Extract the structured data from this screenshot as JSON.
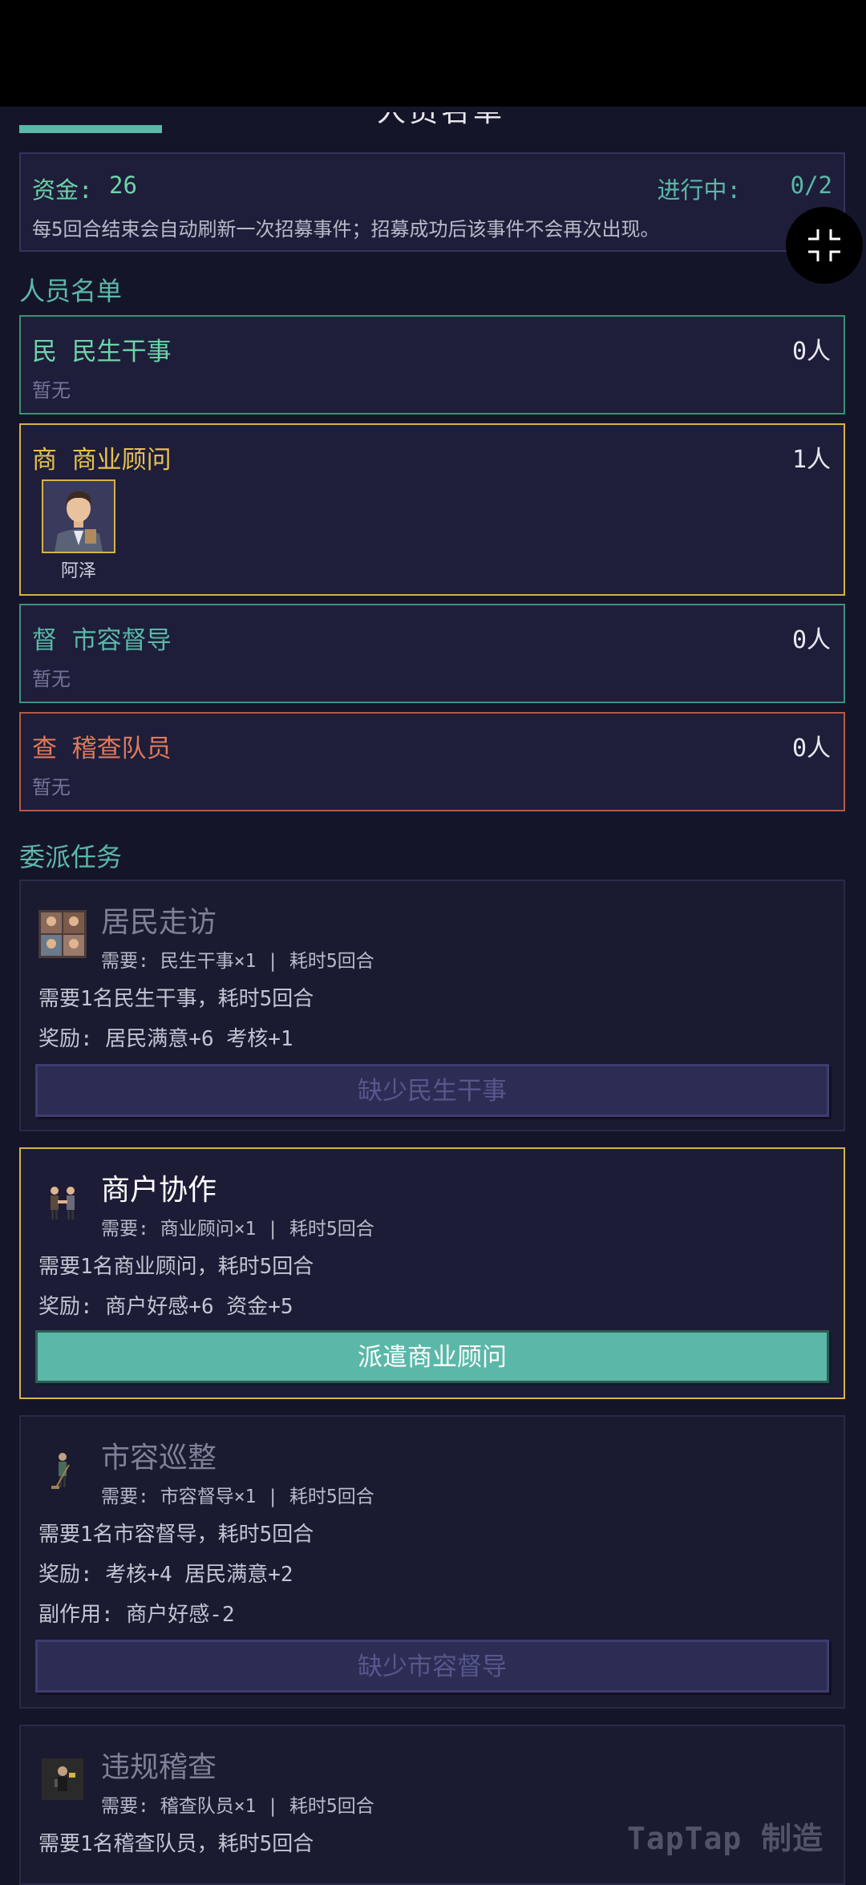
{
  "header": {
    "title_fragment": "人员名单"
  },
  "funds": {
    "label": "资金:",
    "value": "26",
    "progress_label": "进行中:",
    "progress_value": "0/2",
    "note": "每5回合结束会自动刷新一次招募事件；招募成功后该事件不会再次出现。"
  },
  "staff_section": {
    "title": "人员名单",
    "groups": [
      {
        "name": "民  民生干事",
        "count": "0人",
        "empty": "暂无",
        "color": "#6ed3a7"
      },
      {
        "name": "商  商业顾问",
        "count": "1人",
        "member": "阿泽",
        "color": "#e8c14e"
      },
      {
        "name": "督  市容督导",
        "count": "0人",
        "empty": "暂无",
        "color": "#5bb8a8"
      },
      {
        "name": "查  稽查队员",
        "count": "0人",
        "empty": "暂无",
        "color": "#e07a5a"
      }
    ]
  },
  "task_section": {
    "title": "委派任务",
    "tasks": [
      {
        "name": "居民走访",
        "req": "需要: 民生干事×1  |  耗时5回合",
        "desc": "需要1名民生干事，耗时5回合",
        "reward": "奖励: 居民满意+6 考核+1",
        "button": "缺少民生干事",
        "icon": "residents-icon"
      },
      {
        "name": "商户协作",
        "req": "需要: 商业顾问×1  |  耗时5回合",
        "desc": "需要1名商业顾问，耗时5回合",
        "reward": "奖励: 商户好感+6 资金+5",
        "button": "派遣商业顾问",
        "icon": "handshake-icon"
      },
      {
        "name": "市容巡整",
        "req": "需要: 市容督导×1  |  耗时5回合",
        "desc": "需要1名市容督导，耗时5回合",
        "reward": "奖励: 考核+4 居民满意+2",
        "side": "副作用: 商户好感-2",
        "button": "缺少市容督导",
        "icon": "sweeper-icon"
      },
      {
        "name": "违规稽查",
        "req": "需要: 稽查队员×1  |  耗时5回合",
        "desc": "需要1名稽查队员，耗时5回合",
        "icon": "inspector-icon"
      }
    ]
  },
  "watermark": "TapTap 制造"
}
